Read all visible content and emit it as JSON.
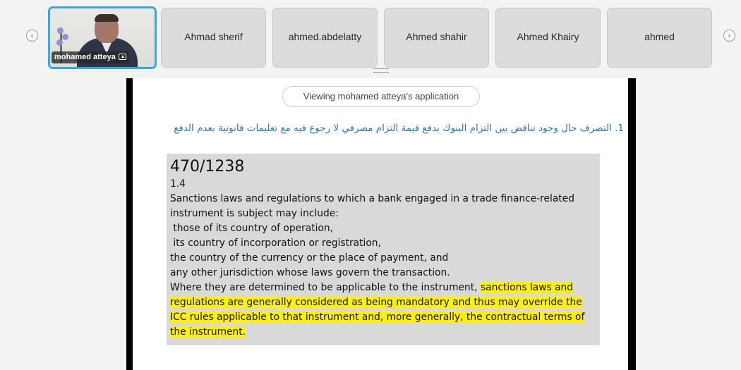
{
  "strip": {
    "prev_icon": "‹",
    "next_icon": "›",
    "active_participant": {
      "name": "mohamed atteya",
      "icon": "screen-share-icon"
    },
    "participants": [
      "Ahmad sherif",
      "ahmed.abdelatty",
      "Ahmed shahir",
      "Ahmed Khairy",
      "ahmed"
    ]
  },
  "content": {
    "viewing_banner": "Viewing mohamed atteya's application",
    "question": "1.  التصرف حال وجود تناقض بين التزام البنوك بدفع قيمة التزام مصرفي لا رجوع فيه مع تعليمات قانونية بعدم الدفع",
    "doc_number": "470/1238",
    "section": "1.4",
    "lines": [
      "Sanctions laws and regulations to which a bank engaged in a trade finance-related",
      "instrument is subject may include:",
      " those of its country of operation,",
      " its country of incorporation or registration,",
      "the country of the currency or the place of payment, and",
      "any other jurisdiction whose laws govern the transaction."
    ],
    "line7_plain": "Where they are determined to be applicable to the instrument, ",
    "line7_highlight": "sanctions laws and",
    "highlighted_lines": [
      "regulations are generally considered as being mandatory and thus may override the",
      "ICC rules applicable to that instrument and, more generally, the contractual terms of",
      "the instrument."
    ],
    "highlight_color": "#fff200",
    "heading_color": "#2e74b5"
  }
}
